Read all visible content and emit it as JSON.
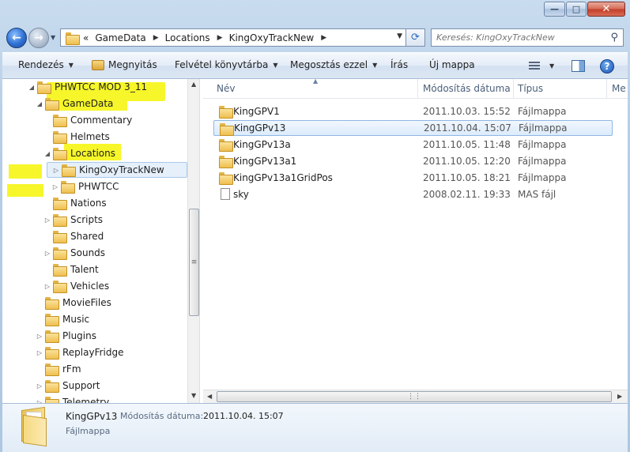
{
  "window": {
    "minimize_glyph": "—",
    "maximize_glyph": "□",
    "close_glyph": "✕"
  },
  "address": {
    "overflow": "«",
    "crumbs": [
      "GameData",
      "Locations",
      "KingOxyTrackNew"
    ],
    "search_placeholder": "Keresés: KingOxyTrackNew"
  },
  "toolbar": {
    "organize": "Rendezés",
    "open": "Megnyitás",
    "add_to_library": "Felvétel könyvtárba",
    "share_with": "Megosztás ezzel",
    "burn": "Írás",
    "new_folder": "Új mappa"
  },
  "icons": {
    "back": "back-arrow-icon",
    "forward": "forward-arrow-icon",
    "refresh": "refresh-icon",
    "search": "search-icon",
    "view": "view-options-icon",
    "preview_pane": "preview-pane-icon",
    "help": "help-icon",
    "folder": "folder-icon",
    "file": "file-icon"
  },
  "nav_tree": [
    {
      "label": "PHWTCC MOD 3_11",
      "expander": "◢",
      "highlight": true
    },
    {
      "label": "GameData",
      "expander": "◢",
      "highlight": true
    },
    {
      "label": "Commentary",
      "expander": ""
    },
    {
      "label": "Helmets",
      "expander": ""
    },
    {
      "label": "Locations",
      "expander": "◢",
      "highlight": true
    },
    {
      "label": "KingOxyTrackNew",
      "expander": "▷",
      "selected": true
    },
    {
      "label": "PHWTCC",
      "expander": "▷"
    },
    {
      "label": "Nations",
      "expander": ""
    },
    {
      "label": "Scripts",
      "expander": "▷"
    },
    {
      "label": "Shared",
      "expander": ""
    },
    {
      "label": "Sounds",
      "expander": "▷"
    },
    {
      "label": "Talent",
      "expander": ""
    },
    {
      "label": "Vehicles",
      "expander": "▷"
    },
    {
      "label": "MovieFiles",
      "expander": ""
    },
    {
      "label": "Music",
      "expander": ""
    },
    {
      "label": "Plugins",
      "expander": "▷"
    },
    {
      "label": "ReplayFridge",
      "expander": "▷"
    },
    {
      "label": "rFm",
      "expander": ""
    },
    {
      "label": "Support",
      "expander": "▷"
    },
    {
      "label": "Telemetry",
      "expander": "▷"
    }
  ],
  "columns": {
    "name": "Név",
    "modified": "Módosítás dátuma",
    "type": "Típus",
    "size_partial": "Me"
  },
  "files": [
    {
      "name": "KingGPV1",
      "modified": "2011.10.03. 15:52",
      "type": "Fájlmappa",
      "kind": "folder"
    },
    {
      "name": "KingGPv13",
      "modified": "2011.10.04. 15:07",
      "type": "Fájlmappa",
      "kind": "folder",
      "selected": true
    },
    {
      "name": "KingGPv13a",
      "modified": "2011.10.05. 11:48",
      "type": "Fájlmappa",
      "kind": "folder"
    },
    {
      "name": "KingGPv13a1",
      "modified": "2011.10.05. 12:20",
      "type": "Fájlmappa",
      "kind": "folder"
    },
    {
      "name": "KingGPv13a1GridPos",
      "modified": "2011.10.05. 18:21",
      "type": "Fájlmappa",
      "kind": "folder"
    },
    {
      "name": "sky",
      "modified": "2008.02.11. 19:33",
      "type": "MAS fájl",
      "kind": "file"
    }
  ],
  "details": {
    "name": "KingGPv13",
    "date_label": "Módosítás dátuma:",
    "date": "2011.10.04. 15:07",
    "type": "Fájlmappa"
  },
  "colors": {
    "highlight": "#f8f830",
    "selection": "#dcebfc",
    "frame": "#b6cde6"
  }
}
